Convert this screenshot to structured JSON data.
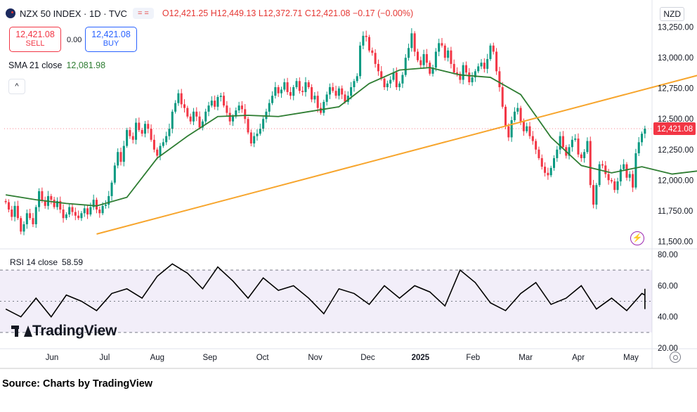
{
  "header": {
    "title": "NZX 50 INDEX · 1D · TVC",
    "ohlc_text": "O12,421.25 H12,449.13 L12,372.71 C12,421.08 −0.17 (−0.00%)",
    "currency": "NZD"
  },
  "trade": {
    "sell_price": "12,421.08",
    "sell_label": "SELL",
    "spread": "0.00",
    "buy_price": "12,421.08",
    "buy_label": "BUY"
  },
  "indicators": {
    "sma_label": "SMA 21 close",
    "sma_value": "12,081.98",
    "rsi_label": "RSI 14 close",
    "rsi_value": "58.59"
  },
  "watermark": "TradingView",
  "source": "Source: Charts by TradingView",
  "colors": {
    "up": "#089981",
    "down": "#f23645",
    "sma": "#2e7d32",
    "trendline": "#f7a52c",
    "rsi": "#000000",
    "rsi_band": "#7e57c2",
    "price_label": "#f23645"
  },
  "chart_data": [
    {
      "type": "candlestick",
      "title": "NZX 50 INDEX · 1D · TVC",
      "y_axis_ticks": [
        "13,250.00",
        "13,000.00",
        "12,750.00",
        "12,500.00",
        "12,250.00",
        "12,000.00",
        "11,750.00",
        "11,500.00"
      ],
      "ylim": [
        11450,
        13300
      ],
      "x_axis_ticks": [
        "Jun",
        "Jul",
        "Aug",
        "Sep",
        "Oct",
        "Nov",
        "Dec",
        "2025",
        "Feb",
        "Mar",
        "Apr",
        "May"
      ],
      "last_price_label": "12,421.08",
      "series": [
        {
          "name": "SMA 21 close",
          "kind": "line",
          "x": [
            0,
            10,
            20,
            30,
            40,
            50,
            60,
            70,
            80,
            90,
            100,
            110,
            120,
            130,
            140,
            150,
            160,
            170,
            180,
            190,
            200,
            210,
            220,
            230
          ],
          "y": [
            11880,
            11840,
            11810,
            11790,
            11860,
            12180,
            12360,
            12520,
            12530,
            12520,
            12560,
            12600,
            12790,
            12900,
            12920,
            12860,
            12840,
            12700,
            12350,
            12120,
            12060,
            12110,
            12050,
            12080
          ]
        },
        {
          "name": "Trend line",
          "kind": "line",
          "x": [
            30,
            232
          ],
          "y": [
            11560,
            12880
          ]
        }
      ],
      "candles_close": [
        11820,
        11760,
        11700,
        11790,
        11690,
        11580,
        11640,
        11730,
        11690,
        11640,
        11780,
        11910,
        11830,
        11790,
        11870,
        11840,
        11780,
        11830,
        11760,
        11690,
        11720,
        11780,
        11740,
        11710,
        11690,
        11730,
        11770,
        11720,
        11780,
        11840,
        11760,
        11730,
        11790,
        11800,
        11870,
        11980,
        12120,
        12230,
        12150,
        12280,
        12410,
        12360,
        12330,
        12470,
        12410,
        12380,
        12460,
        12420,
        12330,
        12250,
        12200,
        12280,
        12310,
        12360,
        12420,
        12560,
        12630,
        12710,
        12620,
        12590,
        12520,
        12480,
        12560,
        12520,
        12430,
        12480,
        12560,
        12610,
        12650,
        12600,
        12680,
        12690,
        12610,
        12550,
        12480,
        12520,
        12570,
        12610,
        12580,
        12500,
        12390,
        12300,
        12360,
        12380,
        12420,
        12500,
        12560,
        12630,
        12690,
        12760,
        12710,
        12740,
        12800,
        12720,
        12690,
        12760,
        12810,
        12730,
        12720,
        12800,
        12760,
        12660,
        12690,
        12590,
        12550,
        12640,
        12700,
        12760,
        12730,
        12690,
        12750,
        12700,
        12640,
        12690,
        12760,
        12810,
        12850,
        13100,
        13180,
        13170,
        13060,
        13040,
        12950,
        12890,
        12830,
        12760,
        12790,
        12820,
        12880,
        12760,
        12790,
        12860,
        13000,
        13080,
        13200,
        13050,
        12980,
        12940,
        13030,
        12960,
        12870,
        12920,
        13050,
        13120,
        13100,
        13000,
        13060,
        12950,
        12880,
        12870,
        12820,
        12940,
        12880,
        12800,
        12840,
        12890,
        12930,
        12960,
        12910,
        12990,
        13100,
        13050,
        12890,
        12760,
        12600,
        12440,
        12350,
        12490,
        12560,
        12590,
        12480,
        12400,
        12440,
        12360,
        12320,
        12250,
        12180,
        12110,
        12060,
        12040,
        12100,
        12180,
        12250,
        12360,
        12270,
        12200,
        12270,
        12330,
        12340,
        12210,
        12180,
        12230,
        12320,
        11960,
        11800,
        11960,
        12130,
        12120,
        12050,
        12000,
        11990,
        11920,
        11990,
        12090,
        12130,
        12020,
        12050,
        11940,
        12220,
        12310,
        12380,
        12421
      ]
    },
    {
      "type": "line",
      "title": "RSI 14 close",
      "y_axis_ticks": [
        "80.00",
        "60.00",
        "40.00",
        "20.00"
      ],
      "ylim": [
        20,
        80
      ],
      "band": [
        30,
        70
      ],
      "midline": 50,
      "x": [
        0,
        5,
        10,
        15,
        20,
        25,
        30,
        35,
        40,
        45,
        50,
        55,
        60,
        65,
        70,
        75,
        80,
        85,
        90,
        95,
        100,
        105,
        110,
        115,
        120,
        125,
        130,
        135,
        140,
        145,
        150,
        155,
        160,
        165,
        170,
        175,
        180,
        185,
        190,
        195,
        200,
        205,
        210,
        215,
        220,
        225,
        230
      ],
      "y": [
        45,
        40,
        52,
        40,
        54,
        50,
        44,
        55,
        58,
        52,
        66,
        74,
        68,
        58,
        72,
        63,
        52,
        65,
        57,
        60,
        52,
        42,
        58,
        55,
        48,
        60,
        52,
        60,
        56,
        47,
        70,
        62,
        49,
        44,
        55,
        62,
        48,
        52,
        60,
        45,
        52,
        44,
        55,
        54,
        45,
        55,
        58
      ]
    }
  ]
}
